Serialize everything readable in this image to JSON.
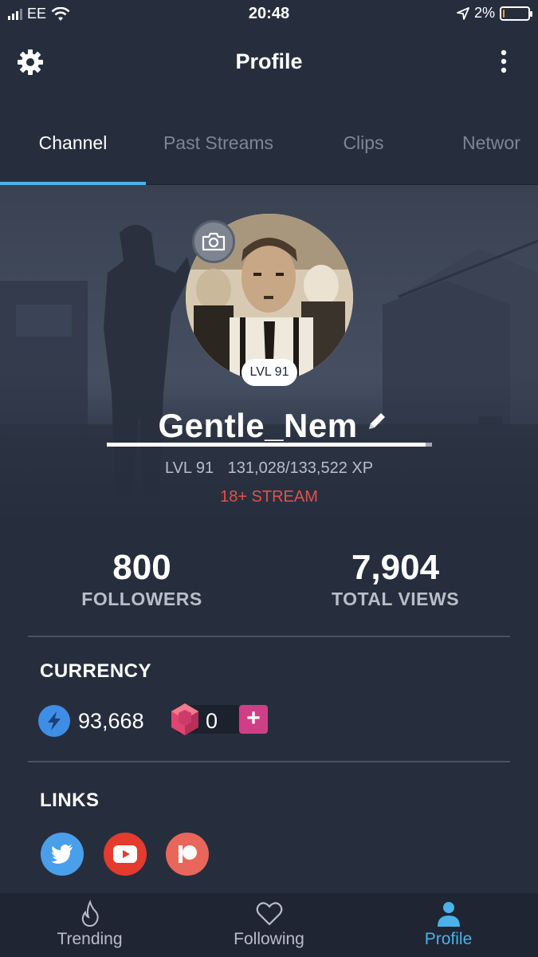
{
  "status_bar": {
    "carrier": "EE",
    "time": "20:48",
    "battery": "2%",
    "battery_level": 0.02
  },
  "header": {
    "title": "Profile"
  },
  "tabs": [
    {
      "label": "Channel",
      "active": true
    },
    {
      "label": "Past Streams",
      "active": false
    },
    {
      "label": "Clips",
      "active": false
    },
    {
      "label": "Networ",
      "active": false
    }
  ],
  "profile": {
    "level_badge": "LVL 91",
    "username": "Gentle_Nem",
    "level": "LVL 91",
    "xp": "131,028/133,522 XP",
    "xp_progress": 0.981,
    "adult_badge": "18+ STREAM"
  },
  "stats": {
    "followers_value": "800",
    "followers_label": "FOLLOWERS",
    "views_value": "7,904",
    "views_label": "TOTAL VIEWS"
  },
  "currency": {
    "title": "CURRENCY",
    "bolts": "93,668",
    "gems": "0",
    "add_label": "+"
  },
  "links": {
    "title": "LINKS",
    "items": [
      "twitter-icon",
      "youtube-icon",
      "patreon-icon"
    ]
  },
  "colors": {
    "background": "#262e3e",
    "accent": "#4ab2e8",
    "adult_badge": "#e0524a",
    "twitter": "#4a9fea",
    "youtube": "#e33b2e",
    "patreon": "#e8675a",
    "gem_add": "#cf3f86"
  },
  "bottom_nav": [
    {
      "label": "Trending",
      "icon": "flame-icon",
      "active": false
    },
    {
      "label": "Following",
      "icon": "heart-icon",
      "active": false
    },
    {
      "label": "Profile",
      "icon": "person-icon",
      "active": true
    }
  ]
}
